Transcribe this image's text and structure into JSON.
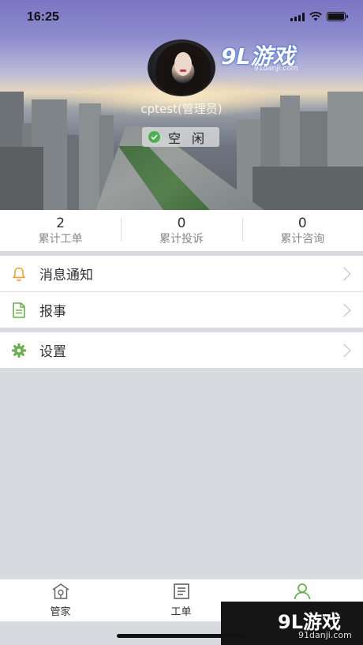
{
  "status_bar": {
    "time": "16:25"
  },
  "profile": {
    "username": "cptest(管理员)",
    "status": "空闲"
  },
  "watermark": {
    "logo": "9L游戏",
    "url": "91danji.com"
  },
  "stats": [
    {
      "value": "2",
      "label": "累计工单"
    },
    {
      "value": "0",
      "label": "累计投诉"
    },
    {
      "value": "0",
      "label": "累计咨询"
    }
  ],
  "menu": [
    {
      "label": "消息通知",
      "icon": "bell-icon",
      "color": "#f0a030"
    },
    {
      "label": "报事",
      "icon": "document-icon",
      "color": "#6ab04c"
    },
    {
      "label": "设置",
      "icon": "gear-icon",
      "color": "#6ab04c"
    }
  ],
  "tabs": [
    {
      "label": "管家",
      "icon": "house-icon"
    },
    {
      "label": "工单",
      "icon": "list-icon"
    },
    {
      "label": "",
      "icon": "person-icon",
      "active": true
    }
  ],
  "colors": {
    "accent": "#6ab04c",
    "tab_active": "#6ab04c"
  }
}
